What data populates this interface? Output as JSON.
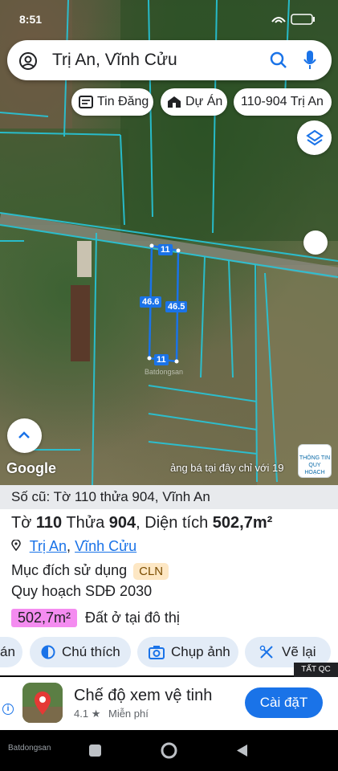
{
  "status": {
    "time": "8:51",
    "battery": "55"
  },
  "search": {
    "query": "Trị An, Vĩnh Cửu"
  },
  "chips": [
    {
      "label": "Tin Đăng",
      "icon": "listing-icon"
    },
    {
      "label": "Dự Án",
      "icon": "building-icon"
    },
    {
      "label": "110-904 Trị An",
      "icon": ""
    }
  ],
  "map": {
    "parcel_labels": [
      "11",
      "46.6",
      "46.5",
      "11"
    ],
    "google_logo": "Google",
    "ad_strip": "ảng bá tại đây chỉ với 19",
    "info_badge_line1": "THÔNG TIN",
    "info_badge_line2": "QUY HOẠCH",
    "watermark": "Batdongsan"
  },
  "panel": {
    "old_info": "Số cũ: Tờ 110 thửa 904, Vĩnh An",
    "to_label": "Tờ",
    "to_value": "110",
    "thua_label": "Thửa",
    "thua_value": "904",
    "area_label": "Diện tích",
    "area_value": "502,7m²",
    "location_ward": "Trị An",
    "location_district": "Vĩnh Cửu",
    "location_sep": ", ",
    "purpose_label": "Mục đích sử dụng",
    "purpose_code": "CLN",
    "plan_label": "Quy hoạch SDĐ 2030",
    "plan_area": "502,7m²",
    "plan_type": "Đất ở tại đô thị"
  },
  "actions": [
    {
      "label": "án"
    },
    {
      "label": "Chú thích",
      "icon": "legend-icon"
    },
    {
      "label": "Chụp ảnh",
      "icon": "camera-icon"
    },
    {
      "label": "Vẽ lại",
      "icon": "redraw-icon"
    }
  ],
  "ad": {
    "tag": "TẤT QC",
    "title": "Chế độ xem vệ tinh",
    "rating": "4.1",
    "price": "Miễn phí",
    "cta": "Cài đặT"
  },
  "footer": {
    "brand": "Batdongsan"
  }
}
